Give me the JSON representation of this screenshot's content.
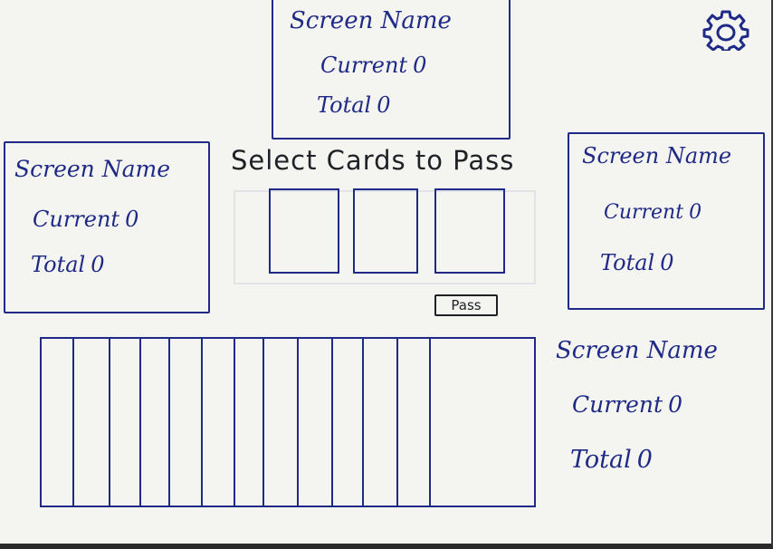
{
  "players": {
    "top": {
      "name": "Screen Name",
      "current_label": "Current",
      "current_value": "0",
      "total_label": "Total",
      "total_value": "0"
    },
    "left": {
      "name": "Screen Name",
      "current_label": "Current",
      "current_value": "0",
      "total_label": "Total",
      "total_value": "0"
    },
    "right": {
      "name": "Screen Name",
      "current_label": "Current",
      "current_value": "0",
      "total_label": "Total",
      "total_value": "0"
    },
    "bottom": {
      "name": "Screen Name",
      "current_label": "Current",
      "current_value": "0",
      "total_label": "Total",
      "total_value": "0"
    }
  },
  "pass_panel": {
    "heading": "Select Cards to Pass",
    "slot_count": 3,
    "pass_button_label": "Pass"
  },
  "hand": {
    "card_count": 13
  },
  "icons": {
    "settings": "gear-icon"
  },
  "colors": {
    "ink": "#1f2a86",
    "pencil": "#1e2226",
    "paper": "#f4f4f1"
  }
}
